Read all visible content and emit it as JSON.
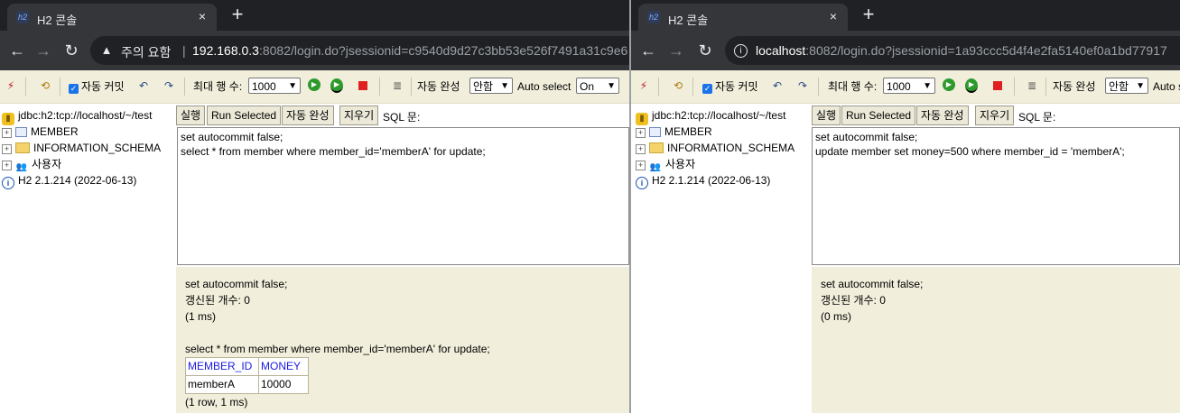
{
  "left": {
    "tab": {
      "title": "H2 콘솔",
      "favicon": "h2-icon",
      "close": "×"
    },
    "newtab": "+",
    "address": {
      "security_label": "주의 요함",
      "url_host": "192.168.0.3",
      "url_rest": ":8082/login.do?jsessionid=c9540d9d27c3bb53e526f7491a31c9e6"
    },
    "toolbar": {
      "autocommit_label": "자동 커밋",
      "max_rows_label": "최대 행 수:",
      "max_rows_value": "1000",
      "autocomplete_label": "자동 완성",
      "autocomplete_value": "안함",
      "autoselect_label": "Auto select",
      "autoselect_value": "On"
    },
    "tree": {
      "connection": "jdbc:h2:tcp://localhost/~/test",
      "items": [
        "MEMBER",
        "INFORMATION_SCHEMA",
        "사용자"
      ],
      "version": "H2 2.1.214 (2022-06-13)"
    },
    "sqlbar": {
      "run": "실행",
      "run_selected": "Run Selected",
      "autocomplete": "자동 완성",
      "clear": "지우기",
      "sql_label": "SQL 문:"
    },
    "editor": [
      "set autocommit false;",
      "select * from member where member_id='memberA' for update;"
    ],
    "results": {
      "stmt1": "set autocommit false;",
      "stmt1_updated": "갱신된 개수: 0",
      "stmt1_time": "(1 ms)",
      "stmt2": "select * from member where member_id='memberA' for update;",
      "columns": [
        "MEMBER_ID",
        "MONEY"
      ],
      "row": [
        "memberA",
        "10000"
      ],
      "stmt2_summary": "(1 row, 1 ms)"
    }
  },
  "right": {
    "tab": {
      "title": "H2 콘솔",
      "favicon": "h2-icon",
      "close": "×"
    },
    "newtab": "+",
    "address": {
      "url_host": "localhost",
      "url_rest": ":8082/login.do?jsessionid=1a93ccc5d4f4e2fa5140ef0a1bd77917"
    },
    "toolbar": {
      "autocommit_label": "자동 커밋",
      "max_rows_label": "최대 행 수:",
      "max_rows_value": "1000",
      "autocomplete_label": "자동 완성",
      "autocomplete_value": "안함",
      "autoselect_label": "Auto s"
    },
    "tree": {
      "connection": "jdbc:h2:tcp://localhost/~/test",
      "items": [
        "MEMBER",
        "INFORMATION_SCHEMA",
        "사용자"
      ],
      "version": "H2 2.1.214 (2022-06-13)"
    },
    "sqlbar": {
      "run": "실행",
      "run_selected": "Run Selected",
      "autocomplete": "자동 완성",
      "clear": "지우기",
      "sql_label": "SQL 문:"
    },
    "editor": [
      "set autocommit false;",
      "update member set money=500 where member_id = 'memberA';"
    ],
    "results": {
      "stmt1": "set autocommit false;",
      "stmt1_updated": "갱신된 개수: 0",
      "stmt1_time": "(0 ms)"
    }
  }
}
